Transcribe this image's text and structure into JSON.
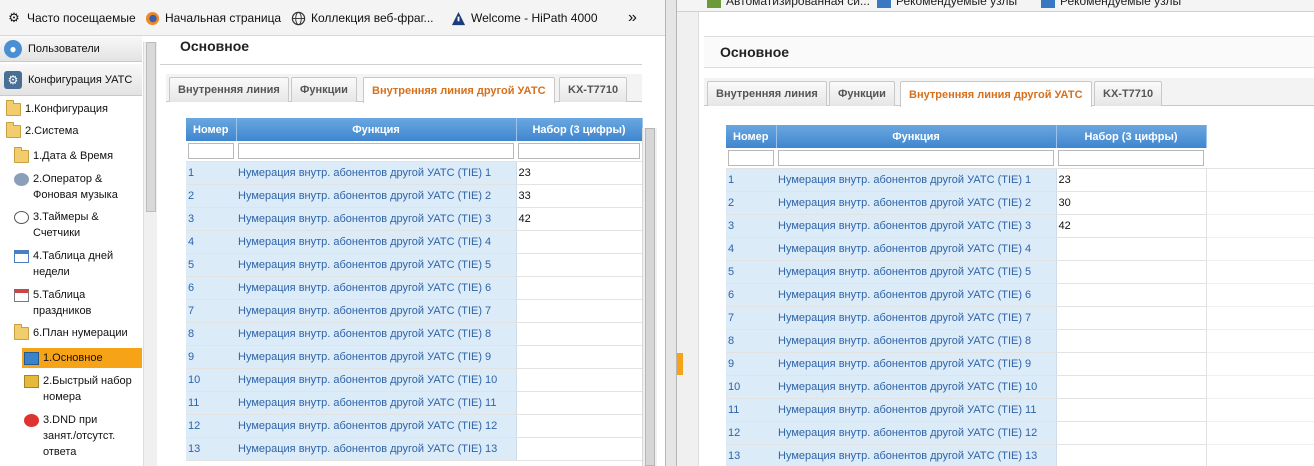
{
  "left": {
    "bookmarks": [
      {
        "label": "Часто посещаемые",
        "icon": "gear-icon"
      },
      {
        "label": "Начальная страница",
        "icon": "firefox-icon"
      },
      {
        "label": "Коллекция веб-фраг...",
        "icon": "globe-icon"
      },
      {
        "label": "Welcome - HiPath 4000",
        "icon": "hipath-icon"
      }
    ],
    "overflow_icon": "double-chevron-right-icon",
    "sidebar": {
      "headers": [
        {
          "label": "Пользователи",
          "icon": "user-icon"
        },
        {
          "label": "Конфигурация УАТС",
          "icon": "settings-icon"
        }
      ],
      "items": [
        {
          "label": "1.Конфигурация",
          "icon": "folder-icon"
        },
        {
          "label": "2.Система",
          "icon": "folder-open-icon"
        },
        {
          "label": "1.Дата & Время",
          "icon": "folder-icon"
        },
        {
          "label": "2.Оператор &",
          "label2": "Фоновая музыка",
          "icon": "operator-icon"
        },
        {
          "label": "3.Таймеры &",
          "label2": "Счетчики",
          "icon": "clock-icon"
        },
        {
          "label": "4.Таблица дней",
          "label2": "недели",
          "icon": "calendar-icon"
        },
        {
          "label": "5.Таблица",
          "label2": "праздников",
          "icon": "calendar-holiday-icon"
        },
        {
          "label": "6.План нумерации",
          "icon": "folder-open-icon"
        },
        {
          "label": "1.Основное",
          "icon": "cube-icon"
        },
        {
          "label": "2.Быстрый набор",
          "label2": "номера",
          "icon": "speed-dial-icon"
        },
        {
          "label": "3.DND при",
          "label2": "занят./отсутст.",
          "label3": "ответа",
          "icon": "dnd-icon"
        }
      ]
    },
    "section_title": "Основное",
    "tabs": [
      "Внутренняя линия",
      "Функции",
      "Внутренняя линия другой УАТС",
      "KX-T7710"
    ],
    "table": {
      "columns": [
        "Номер",
        "Функция",
        "Набор (3 цифры)"
      ],
      "rows": [
        {
          "num": "1",
          "func": "Нумерация внутр. абонентов другой УАТС (TIE) 1",
          "val": "23"
        },
        {
          "num": "2",
          "func": "Нумерация внутр. абонентов другой УАТС (TIE) 2",
          "val": "33"
        },
        {
          "num": "3",
          "func": "Нумерация внутр. абонентов другой УАТС (TIE) 3",
          "val": "42"
        },
        {
          "num": "4",
          "func": "Нумерация внутр. абонентов другой УАТС (TIE) 4",
          "val": ""
        },
        {
          "num": "5",
          "func": "Нумерация внутр. абонентов другой УАТС (TIE) 5",
          "val": ""
        },
        {
          "num": "6",
          "func": "Нумерация внутр. абонентов другой УАТС (TIE) 6",
          "val": ""
        },
        {
          "num": "7",
          "func": "Нумерация внутр. абонентов другой УАТС (TIE) 7",
          "val": ""
        },
        {
          "num": "8",
          "func": "Нумерация внутр. абонентов другой УАТС (TIE) 8",
          "val": ""
        },
        {
          "num": "9",
          "func": "Нумерация внутр. абонентов другой УАТС (TIE) 9",
          "val": ""
        },
        {
          "num": "10",
          "func": "Нумерация внутр. абонентов другой УАТС (TIE) 10",
          "val": ""
        },
        {
          "num": "11",
          "func": "Нумерация внутр. абонентов другой УАТС (TIE) 11",
          "val": ""
        },
        {
          "num": "12",
          "func": "Нумерация внутр. абонентов другой УАТС (TIE) 12",
          "val": ""
        },
        {
          "num": "13",
          "func": "Нумерация внутр. абонентов другой УАТС (TIE) 13",
          "val": ""
        }
      ]
    }
  },
  "right": {
    "bookmarks_cut": [
      "Автоматизированная си...",
      "Рекомендуемые узлы",
      "Рекомендуемые узлы"
    ],
    "section_title": "Основное",
    "tabs": [
      "Внутренняя линия",
      "Функции",
      "Внутренняя линия другой УАТС",
      "KX-T7710"
    ],
    "table": {
      "columns": [
        "Номер",
        "Функция",
        "Набор (3 цифры)"
      ],
      "rows": [
        {
          "num": "1",
          "func": "Нумерация внутр. абонентов другой УАТС (TIE) 1",
          "val": "23"
        },
        {
          "num": "2",
          "func": "Нумерация внутр. абонентов другой УАТС (TIE) 2",
          "val": "30"
        },
        {
          "num": "3",
          "func": "Нумерация внутр. абонентов другой УАТС (TIE) 3",
          "val": "42"
        },
        {
          "num": "4",
          "func": "Нумерация внутр. абонентов другой УАТС (TIE) 4",
          "val": ""
        },
        {
          "num": "5",
          "func": "Нумерация внутр. абонентов другой УАТС (TIE) 5",
          "val": ""
        },
        {
          "num": "6",
          "func": "Нумерация внутр. абонентов другой УАТС (TIE) 6",
          "val": ""
        },
        {
          "num": "7",
          "func": "Нумерация внутр. абонентов другой УАТС (TIE) 7",
          "val": ""
        },
        {
          "num": "8",
          "func": "Нумерация внутр. абонентов другой УАТС (TIE) 8",
          "val": ""
        },
        {
          "num": "9",
          "func": "Нумерация внутр. абонентов другой УАТС (TIE) 9",
          "val": ""
        },
        {
          "num": "10",
          "func": "Нумерация внутр. абонентов другой УАТС (TIE) 10",
          "val": ""
        },
        {
          "num": "11",
          "func": "Нумерация внутр. абонентов другой УАТС (TIE) 11",
          "val": ""
        },
        {
          "num": "12",
          "func": "Нумерация внутр. абонентов другой УАТС (TIE) 12",
          "val": ""
        },
        {
          "num": "13",
          "func": "Нумерация внутр. абонентов другой УАТС (TIE) 13",
          "val": ""
        }
      ]
    }
  },
  "colors": {
    "accent_orange": "#f6a317",
    "active_tab_text": "#d6701c",
    "header_blue": "#4a8fd4",
    "row_blue": "#dcebf8",
    "link_blue": "#2f64a8"
  }
}
